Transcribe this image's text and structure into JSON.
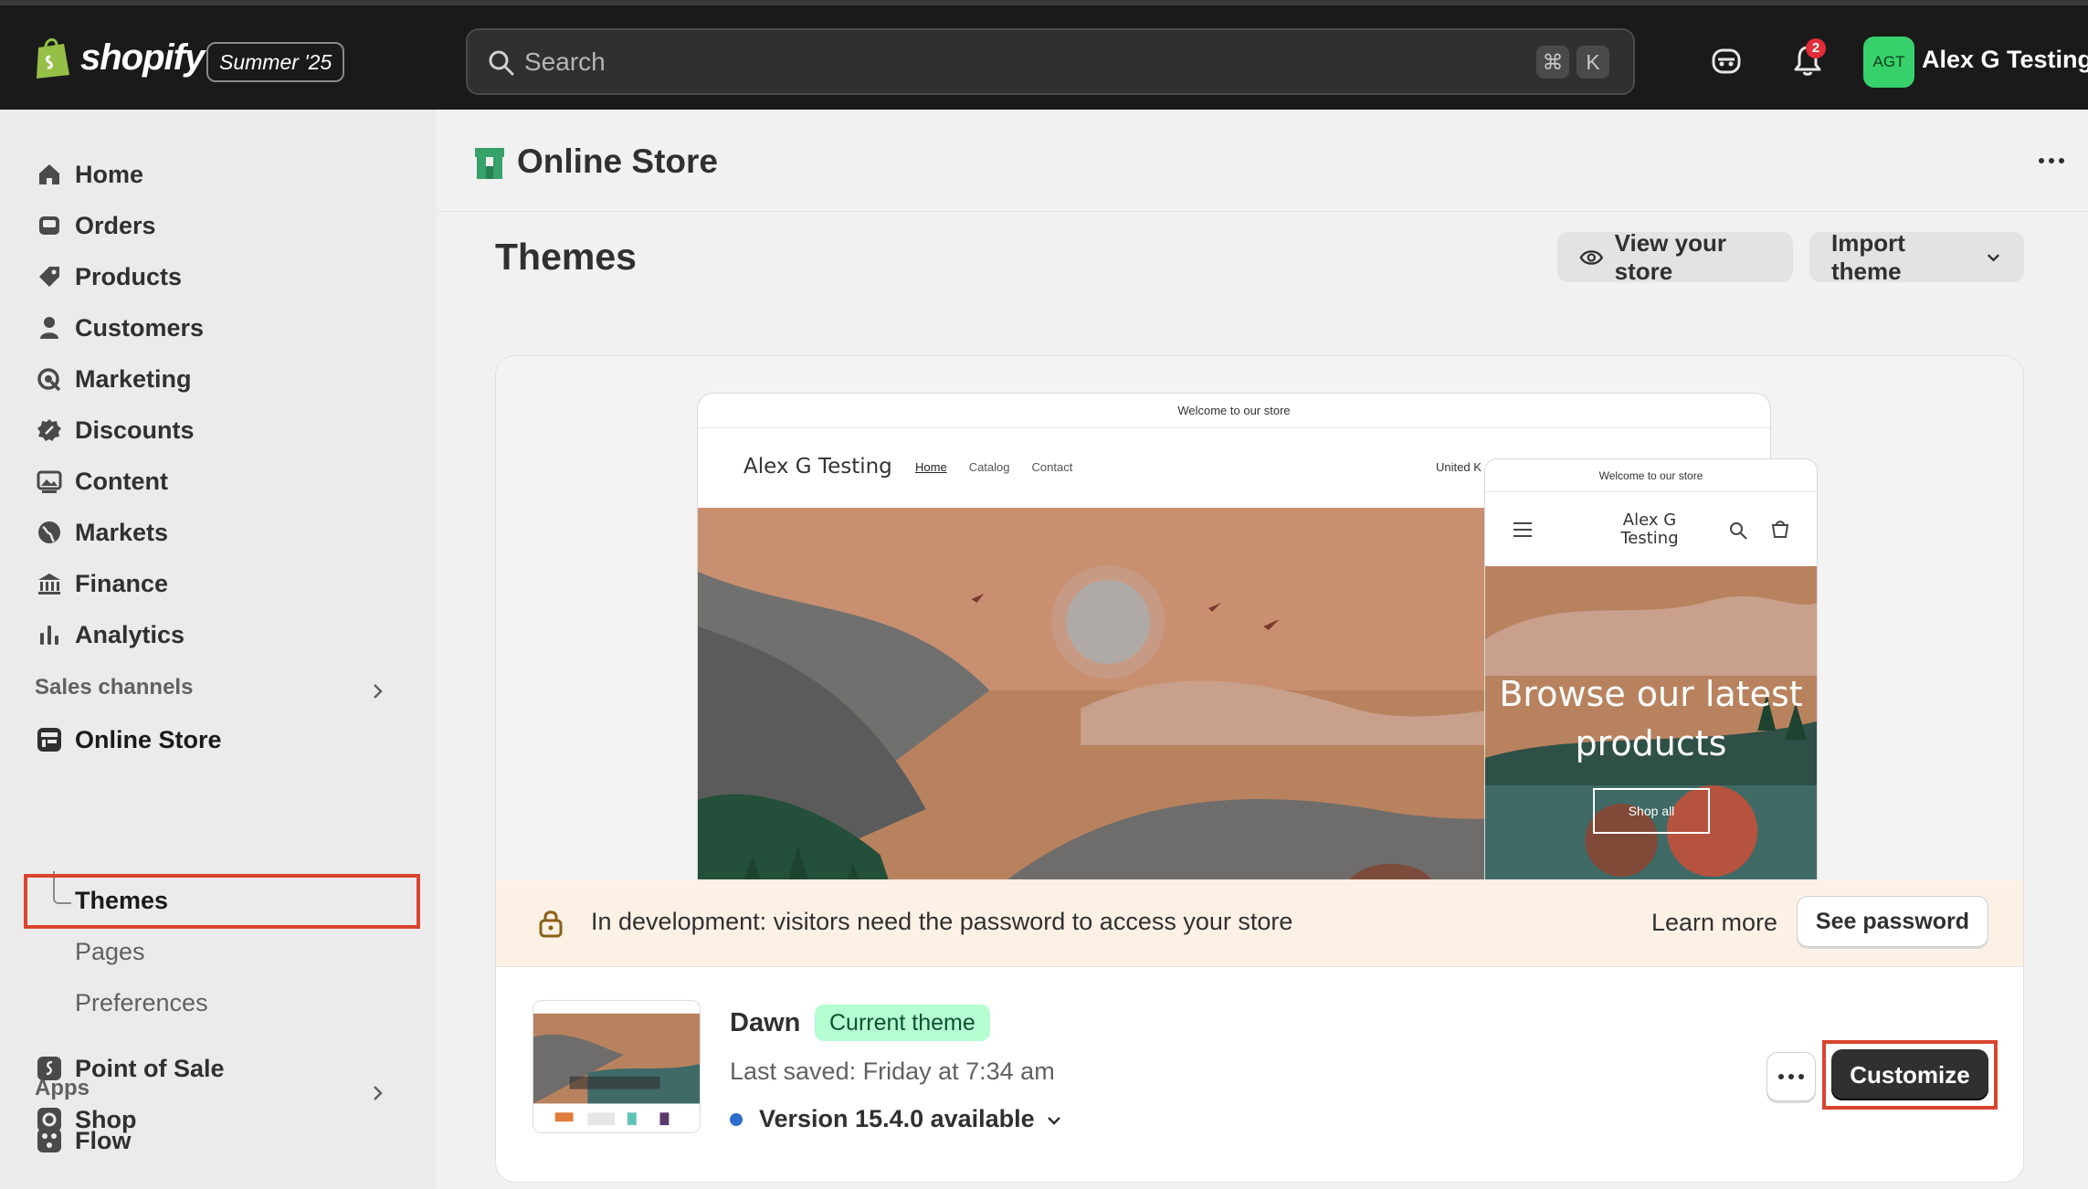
{
  "topbar": {
    "brand": "shopify",
    "edition_badge": "Summer '25",
    "search_placeholder": "Search",
    "shortcut_keys": [
      "⌘",
      "K"
    ],
    "notification_count": "2",
    "avatar_initials": "AGT",
    "user_name": "Alex G Testing"
  },
  "sidebar": {
    "items": [
      {
        "label": "Home",
        "icon": "home-icon"
      },
      {
        "label": "Orders",
        "icon": "inbox-icon"
      },
      {
        "label": "Products",
        "icon": "tag-icon"
      },
      {
        "label": "Customers",
        "icon": "person-icon"
      },
      {
        "label": "Marketing",
        "icon": "target-icon"
      },
      {
        "label": "Discounts",
        "icon": "discount-icon"
      },
      {
        "label": "Content",
        "icon": "image-icon"
      },
      {
        "label": "Markets",
        "icon": "globe-icon"
      },
      {
        "label": "Finance",
        "icon": "bank-icon"
      },
      {
        "label": "Analytics",
        "icon": "bar-chart-icon"
      }
    ],
    "sales_channels_heading": "Sales channels",
    "online_store": "Online Store",
    "sub_items": [
      "Themes",
      "Pages",
      "Preferences"
    ],
    "channels": [
      "Point of Sale",
      "Shop"
    ],
    "apps_heading": "Apps",
    "apps": [
      "Flow"
    ]
  },
  "header": {
    "title": "Online Store"
  },
  "main": {
    "page_title": "Themes",
    "view_store_label": "View your store",
    "import_theme_label": "Import theme"
  },
  "preview": {
    "announcement": "Welcome to our store",
    "store_name": "Alex G Testing",
    "nav_links": [
      "Home",
      "Catalog",
      "Contact"
    ],
    "country": "United K",
    "mobile_store_name": "Alex G Testing",
    "hero_heading": "Browse our latest products",
    "hero_button": "Shop all"
  },
  "dev_banner": {
    "message": "In development: visitors need the password to access your store",
    "learn_more": "Learn more",
    "see_password": "See password"
  },
  "theme": {
    "name": "Dawn",
    "badge": "Current theme",
    "last_saved": "Last saved: Friday at 7:34 am",
    "version": "Version 15.4.0 available",
    "customize_label": "Customize"
  },
  "colors": {
    "topbar_bg": "#1a1a1a",
    "avatar_bg": "#36d16a",
    "badge_green": "#b4fed2",
    "highlight_red": "#d9442e",
    "notification_red": "#e22c38",
    "dev_banner_bg": "#fdf1e6"
  }
}
